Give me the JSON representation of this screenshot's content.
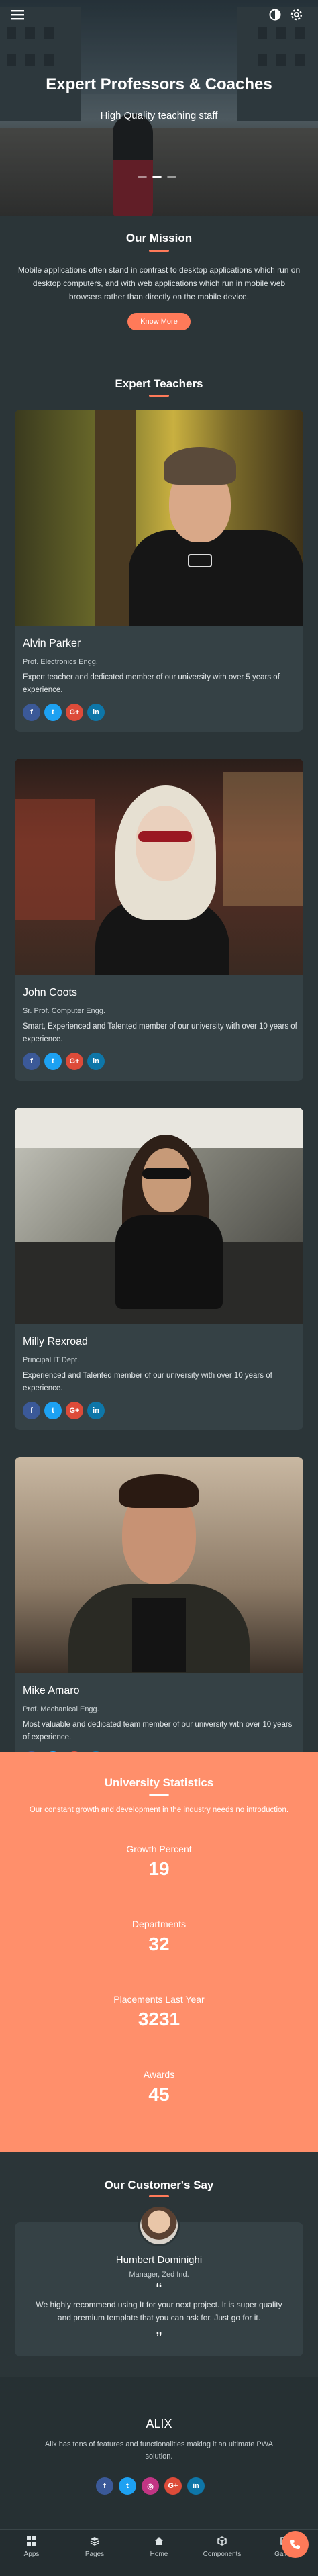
{
  "hero": {
    "title": "Expert Professors & Coaches",
    "subtitle": "High Quality teaching staff",
    "menu_icon": "hamburger-icon",
    "theme_icon": "half-circle-icon",
    "settings_icon": "gear-icon"
  },
  "mission": {
    "title": "Our Mission",
    "text": "Mobile applications often stand in contrast to desktop applications which run on desktop computers, and with web applications which run in mobile web browsers rather than directly on the mobile device.",
    "button": "Know More"
  },
  "teachers": {
    "title": "Expert Teachers",
    "items": [
      {
        "name": "Alvin Parker",
        "role": "Prof. Electronics Engg.",
        "desc": "Expert teacher and dedicated member of our university with over 5 years of experience."
      },
      {
        "name": "John Coots",
        "role": "Sr. Prof. Computer Engg.",
        "desc": "Smart, Experienced and Talented member of our university with over 10 years of experience."
      },
      {
        "name": "Milly Rexroad",
        "role": "Principal IT Dept.",
        "desc": "Experienced and Talented member of our university with over 10 years of experience."
      },
      {
        "name": "Mike Amaro",
        "role": "Prof. Mechanical Engg.",
        "desc": "Most valuable and dedicated team member of our university with over 10 years of experience."
      }
    ],
    "social": {
      "fb": "f",
      "tw": "t",
      "gp": "G+",
      "li": "in"
    }
  },
  "stats": {
    "title": "University Statistics",
    "subtitle": "Our constant growth and development in the industry needs no introduction.",
    "items": [
      {
        "label": "Growth Percent",
        "value": "19"
      },
      {
        "label": "Departments",
        "value": "32"
      },
      {
        "label": "Placements Last Year",
        "value": "3231"
      },
      {
        "label": "Awards",
        "value": "45"
      }
    ]
  },
  "testimonial": {
    "title": "Our Customer's Say",
    "name": "Humbert Dominighi",
    "role": "Manager, Zed Ind.",
    "quote": "We highly recommend using It for your next project. It is super quality and premium template that you can ask for. Just go for it.",
    "open_quote": "“",
    "close_quote": "”"
  },
  "footer": {
    "brand": "ALIX",
    "text": "Alix has tons of features and functionalities making it an ultimate PWA solution.",
    "social": {
      "fb": "f",
      "tw": "t",
      "ig": "◎",
      "gp": "G+",
      "li": "in"
    }
  },
  "tabbar": {
    "items": [
      {
        "label": "Apps",
        "icon": "grid-icon"
      },
      {
        "label": "Pages",
        "icon": "stack-icon"
      },
      {
        "label": "Home",
        "icon": "home-icon"
      },
      {
        "label": "Components",
        "icon": "cube-icon"
      },
      {
        "label": "Gallery",
        "icon": "image-icon"
      }
    ],
    "fab_icon": "phone-icon"
  },
  "colors": {
    "accent": "#ff7a59",
    "background": "#2b3538",
    "card": "#354145",
    "stats_bg": "#ff8f6b"
  }
}
